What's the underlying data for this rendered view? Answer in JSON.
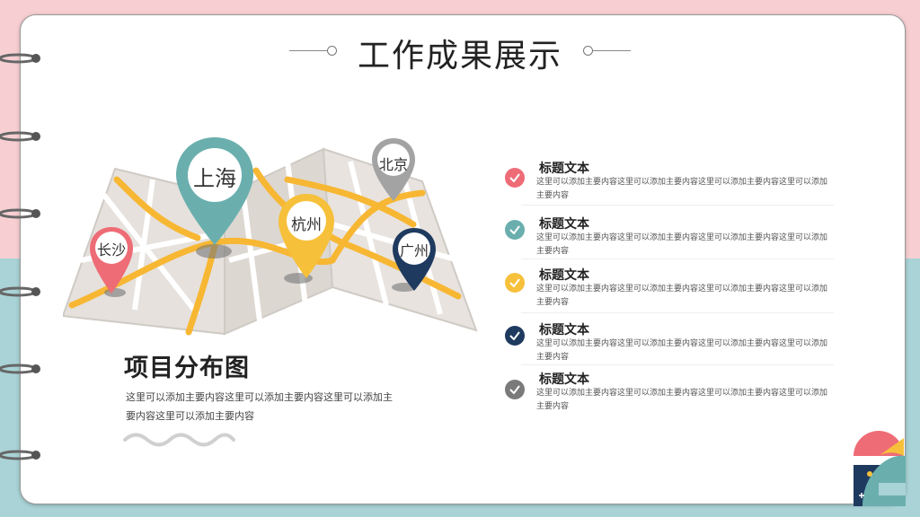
{
  "header": {
    "title": "工作成果展示"
  },
  "map": {
    "pins": [
      {
        "name": "上海",
        "color": "#6aafae"
      },
      {
        "name": "北京",
        "color": "#a3a3a3"
      },
      {
        "name": "杭州",
        "color": "#f6c03b"
      },
      {
        "name": "长沙",
        "color": "#ee6c76"
      },
      {
        "name": "广州",
        "color": "#1f3a5f"
      }
    ]
  },
  "summary": {
    "title": "项目分布图",
    "text": "这里可以添加主要内容这里可以添加主要内容这里可以添加主要内容这里可以添加主要内容"
  },
  "items": [
    {
      "title": "标题文本",
      "text": "这里可以添加主要内容这里可以添加主要内容这里可以添加主要内容这里可以添加主要内容",
      "color": "#ee6c76"
    },
    {
      "title": "标题文本",
      "text": "这里可以添加主要内容这里可以添加主要内容这里可以添加主要内容这里可以添加主要内容",
      "color": "#6aafae"
    },
    {
      "title": "标题文本",
      "text": "这里可以添加主要内容这里可以添加主要内容这里可以添加主要内容这里可以添加主要内容",
      "color": "#f6c03b"
    },
    {
      "title": "标题文本",
      "text": "这里可以添加主要内容这里可以添加主要内容这里可以添加主要内容这里可以添加主要内容",
      "color": "#1f3a5f"
    },
    {
      "title": "标题文本",
      "text": "这里可以添加主要内容这里可以添加主要内容这里可以添加主要内容这里可以添加主要内容",
      "color": "#7a7a7a"
    }
  ]
}
